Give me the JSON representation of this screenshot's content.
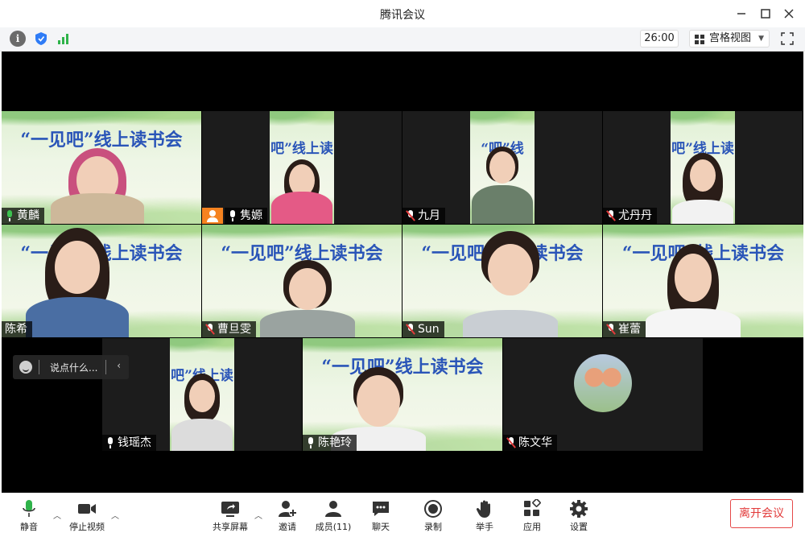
{
  "window": {
    "title": "腾讯会议"
  },
  "toolbar": {
    "timer": "26:00",
    "view_label": "宫格视图"
  },
  "tiles": {
    "huanglin": {
      "name": "黄麟",
      "banner": "“一见吧”线上读书会"
    },
    "juanyuan": {
      "name": "隽嫄",
      "banner": "吧”线上读"
    },
    "jiuyue": {
      "name": "九月",
      "banner": "“吧”线"
    },
    "youdandan": {
      "name": "尤丹丹",
      "banner": "吧”线上读"
    },
    "chenxi": {
      "name": "陈希",
      "banner": "“一见吧”线上读书会"
    },
    "caodanwen": {
      "name": "曹旦雯",
      "banner": "“一见吧”线上读书会"
    },
    "sun": {
      "name": "Sun",
      "banner": "“一见吧”线上读书会"
    },
    "cuilei": {
      "name": "崔蕾",
      "banner": "“一见吧”线上读书会"
    },
    "qianyaojie": {
      "name": "钱瑶杰",
      "banner": "吧”线上读"
    },
    "chenyanling": {
      "name": "陈艳玲",
      "banner": "“一见吧”线上读书会"
    },
    "chenwenhua": {
      "name": "陈文华"
    }
  },
  "chat": {
    "placeholder": "说点什么..."
  },
  "controls": {
    "mute": "静音",
    "stop_video": "停止视频",
    "share_screen": "共享屏幕",
    "invite": "邀请",
    "members": "成员(11)",
    "chat": "聊天",
    "record": "录制",
    "raise_hand": "举手",
    "apps": "应用",
    "settings": "设置",
    "leave": "离开会议"
  },
  "colors": {
    "accent": "#e23b3b",
    "mic_on": "#3cc24f",
    "signal": "#2fb34a",
    "banner_text": "#2a55b8"
  },
  "icons": [
    "info-icon",
    "shield-icon",
    "signal-icon",
    "grid-icon",
    "fullscreen-icon",
    "minimize-icon",
    "maximize-icon",
    "close-icon",
    "microphone-icon",
    "video-camera-icon",
    "share-screen-icon",
    "invite-icon",
    "members-icon",
    "chat-icon",
    "record-icon",
    "raise-hand-icon",
    "apps-icon",
    "settings-icon"
  ]
}
